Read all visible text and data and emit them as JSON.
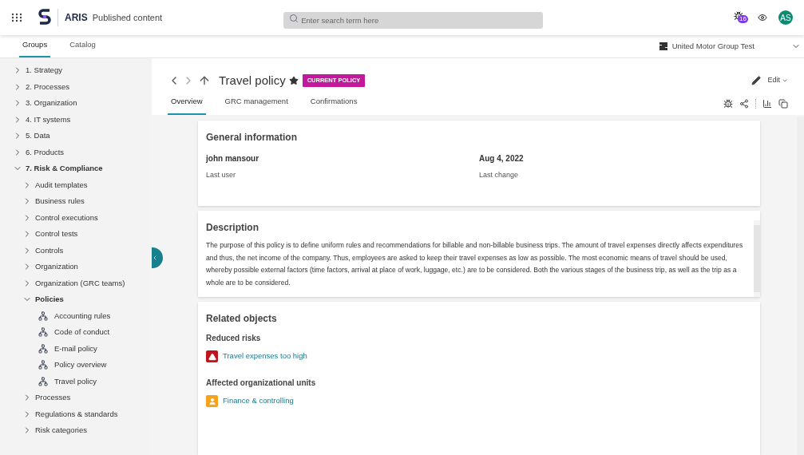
{
  "header": {
    "app": "ARIS",
    "subtitle": "Published content",
    "search": {
      "placeholder": "Enter search term here"
    },
    "notification_count": "16",
    "avatar": "AS"
  },
  "nav_tabs": [
    {
      "label": "Groups",
      "selected": true
    },
    {
      "label": "Catalog",
      "selected": false
    }
  ],
  "database": "United Motor Group Test",
  "tree": [
    {
      "label": "1. Strategy",
      "kind": "folder",
      "expanded": false
    },
    {
      "label": "2. Processes",
      "kind": "folder",
      "expanded": false
    },
    {
      "label": "3. Organization",
      "kind": "folder",
      "expanded": false
    },
    {
      "label": "4. IT systems",
      "kind": "folder",
      "expanded": false
    },
    {
      "label": "5. Data",
      "kind": "folder",
      "expanded": false
    },
    {
      "label": "6. Products",
      "kind": "folder",
      "expanded": false
    },
    {
      "label": "7. Risk & Compliance",
      "kind": "folder",
      "expanded": true,
      "children": [
        {
          "label": "Audit templates",
          "kind": "folder",
          "expanded": false
        },
        {
          "label": "Business rules",
          "kind": "folder",
          "expanded": false
        },
        {
          "label": "Control executions",
          "kind": "folder",
          "expanded": false
        },
        {
          "label": "Control tests",
          "kind": "folder",
          "expanded": false
        },
        {
          "label": "Controls",
          "kind": "folder",
          "expanded": false
        },
        {
          "label": "Organization",
          "kind": "folder",
          "expanded": false
        },
        {
          "label": "Organization (GRC teams)",
          "kind": "folder",
          "expanded": false
        },
        {
          "label": "Policies",
          "kind": "folder",
          "expanded": true,
          "children": [
            {
              "label": "Accounting rules",
              "kind": "model"
            },
            {
              "label": "Code of conduct",
              "kind": "model"
            },
            {
              "label": "E-mail policy",
              "kind": "model"
            },
            {
              "label": "Policy overview",
              "kind": "model"
            },
            {
              "label": "Travel policy",
              "kind": "model"
            }
          ]
        },
        {
          "label": "Processes",
          "kind": "folder",
          "expanded": false
        },
        {
          "label": "Regulations & standards",
          "kind": "folder",
          "expanded": false
        },
        {
          "label": "Risk categories",
          "kind": "folder",
          "expanded": false
        }
      ]
    }
  ],
  "page": {
    "title": "Travel policy",
    "badge": "CURRENT POLICY",
    "edit": "Edit",
    "tabs": [
      {
        "label": "Overview",
        "selected": true
      },
      {
        "label": "GRC management",
        "selected": false
      },
      {
        "label": "Confirmations",
        "selected": false
      }
    ]
  },
  "general_information": {
    "title": "General information",
    "fields": [
      {
        "value": "john mansour",
        "label": "Last user"
      },
      {
        "value": "Aug 4, 2022",
        "label": "Last change"
      }
    ]
  },
  "description": {
    "title": "Description",
    "text": "The purpose of this policy is to define uniform rules and recommendations for billable and non-billable business trips. The amount of travel expenses directly affects expenditures and thus, the net income of the company. Thus, employees are asked to keep their travel expenses as low as possible. The most economic means of travel should be used, whereby possible external factors (time factors, arrival at place of work, luggage, etc.) are to be considered. Both the various stages of the business trip, as well as the trip as a whole are to be considered."
  },
  "related_objects": {
    "title": "Related objects",
    "groups": [
      {
        "title": "Reduced risks",
        "items": [
          {
            "label": "Travel expenses too high",
            "kind": "risk",
            "color": "#c0141c"
          }
        ]
      },
      {
        "title": "Affected organizational units",
        "items": [
          {
            "label": "Finance & controlling",
            "kind": "orgunit",
            "color": "#f7a21b"
          }
        ]
      }
    ]
  }
}
